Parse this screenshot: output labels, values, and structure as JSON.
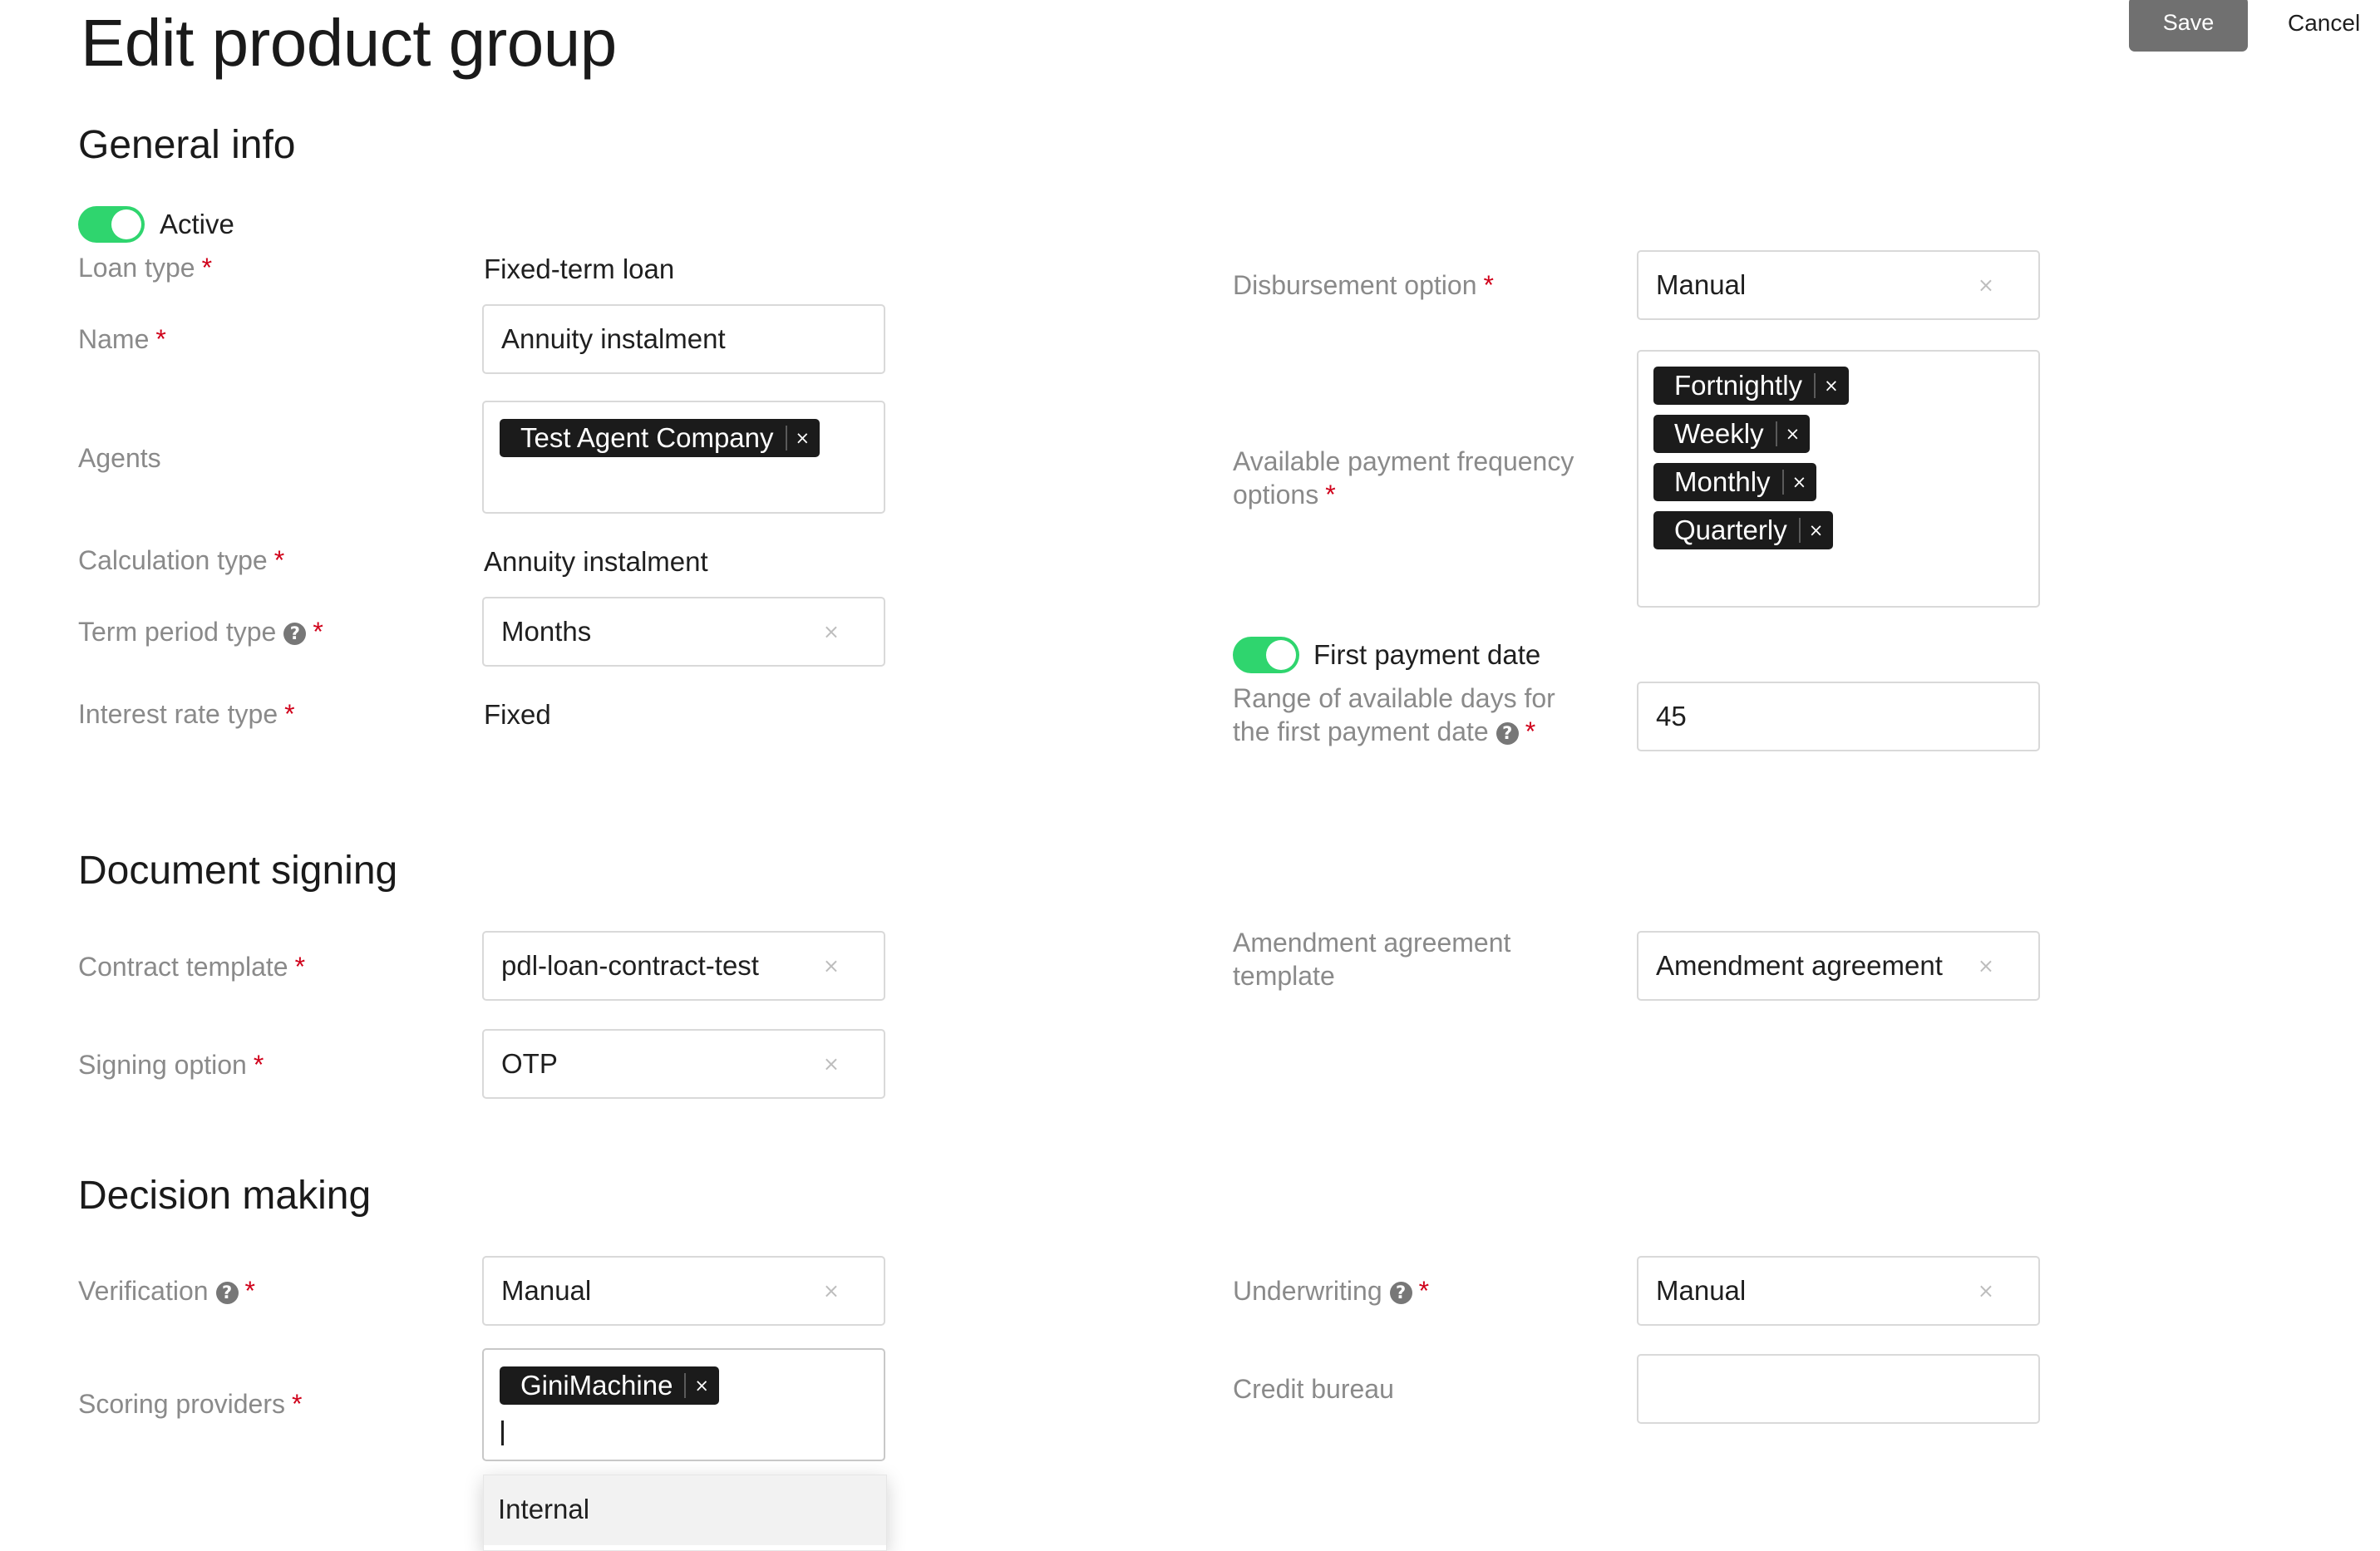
{
  "header": {
    "title": "Edit product group",
    "save_label": "Save",
    "cancel_label": "Cancel"
  },
  "general_info": {
    "title": "General info",
    "active_label": "Active",
    "loan_type_label": "Loan type",
    "loan_type_value": "Fixed-term loan",
    "name_label": "Name",
    "name_value": "Annuity instalment",
    "agents_label": "Agents",
    "agents": [
      "Test Agent Company"
    ],
    "calculation_type_label": "Calculation type",
    "calculation_type_value": "Annuity instalment",
    "term_period_type_label": "Term period type",
    "term_period_type_value": "Months",
    "interest_rate_type_label": "Interest rate type",
    "interest_rate_type_value": "Fixed",
    "disbursement_option_label": "Disbursement option",
    "disbursement_option_value": "Manual",
    "payment_frequency_label_line1": "Available payment frequency",
    "payment_frequency_label_line2": "options",
    "payment_frequencies": [
      "Fortnightly",
      "Weekly",
      "Monthly",
      "Quarterly"
    ],
    "first_payment_date_label": "First payment date",
    "first_payment_range_label_line1": "Range of available days for",
    "first_payment_range_label_line2": "the first payment date",
    "first_payment_range_value": "45"
  },
  "document_signing": {
    "title": "Document signing",
    "contract_template_label": "Contract template",
    "contract_template_value": "pdl-loan-contract-test",
    "signing_option_label": "Signing option",
    "signing_option_value": "OTP",
    "amendment_label_line1": "Amendment agreement",
    "amendment_label_line2": "template",
    "amendment_value": "Amendment agreement"
  },
  "decision_making": {
    "title": "Decision making",
    "verification_label": "Verification",
    "verification_value": "Manual",
    "underwriting_label": "Underwriting",
    "underwriting_value": "Manual",
    "scoring_providers_label": "Scoring providers",
    "scoring_providers": [
      "GiniMachine"
    ],
    "credit_bureau_label": "Credit bureau",
    "credit_bureau_value": "",
    "dropdown_options": [
      "Internal"
    ]
  },
  "icons": {
    "required_marker": "*",
    "clear": "×",
    "help": "?"
  },
  "colors": {
    "toggle_on": "#2fd56e",
    "required": "#d0021b",
    "tag_bg": "#1b1b1b",
    "save_button_bg": "#707070"
  }
}
